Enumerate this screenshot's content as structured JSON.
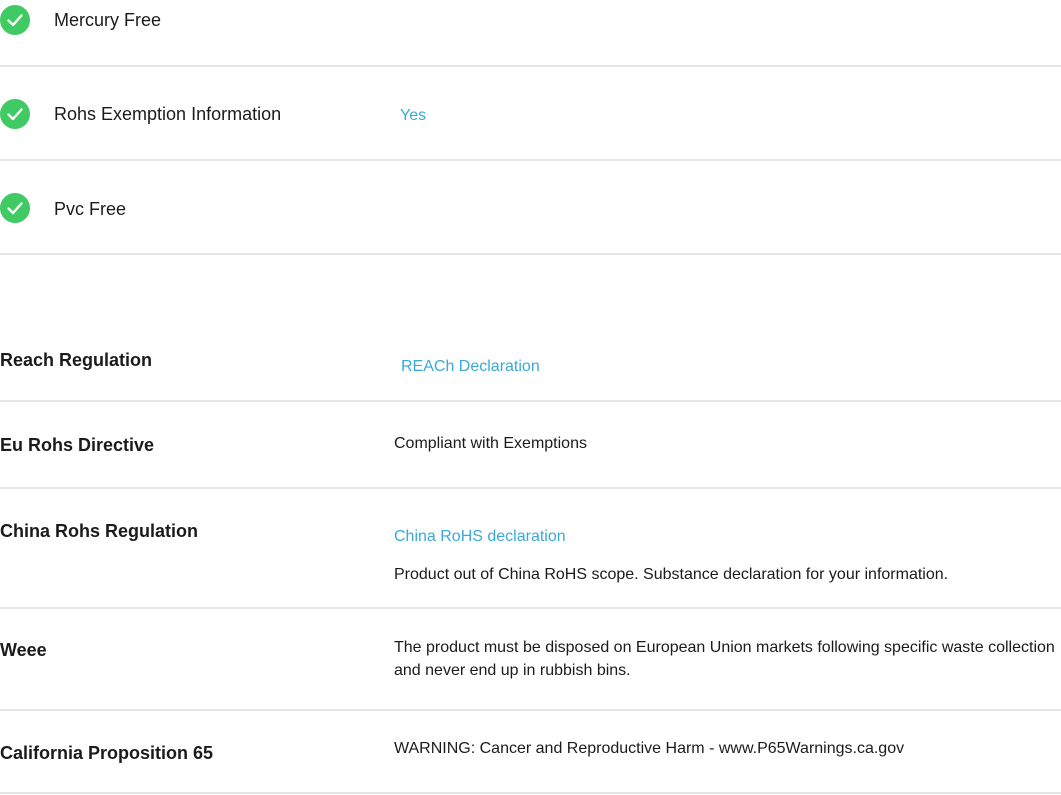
{
  "environmental_features": [
    {
      "label": "Mercury Free",
      "value": "",
      "icon": "check-circle-icon"
    },
    {
      "label": "Rohs Exemption Information",
      "value": "Yes",
      "icon": "check-circle-icon"
    },
    {
      "label": "Pvc Free",
      "value": "",
      "icon": "check-circle-icon"
    }
  ],
  "regulations": {
    "reach": {
      "label": "Reach Regulation",
      "link": "REACh Declaration"
    },
    "eu_rohs": {
      "label": "Eu Rohs Directive",
      "text": "Compliant with Exemptions"
    },
    "china_rohs": {
      "label": "China Rohs Regulation",
      "link": "China RoHS declaration",
      "text": "Product out of China RoHS scope. Substance declaration for your information."
    },
    "weee": {
      "label": "Weee",
      "text": "The product must be disposed on European Union markets following specific waste collection and never end up in rubbish bins."
    },
    "prop65": {
      "label": "California Proposition 65",
      "text": "WARNING: Cancer and Reproductive Harm - www.P65Warnings.ca.gov"
    }
  },
  "colors": {
    "check_green": "#3fca63",
    "link_blue": "#3aa9d8",
    "divider_gray": "#e6e6e6"
  }
}
